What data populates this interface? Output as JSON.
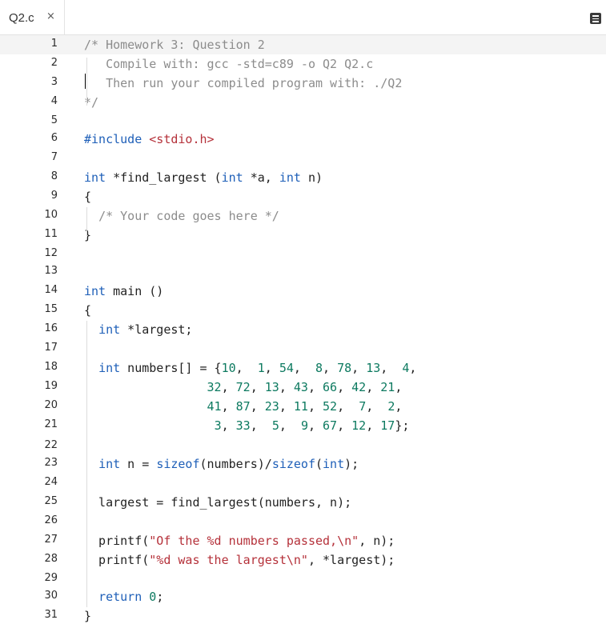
{
  "tab": {
    "title": "Q2.c",
    "close_icon": "×"
  },
  "menu": {
    "icon": "hamburger-menu-icon"
  },
  "colors": {
    "keyword": "#1e5fb8",
    "number": "#0d7a60",
    "string": "#b5313a",
    "comment": "#8c8c8c",
    "text": "#222222"
  },
  "lines": [
    [
      [
        "cm",
        "/* Homework 3: Question 2"
      ]
    ],
    [
      [
        "cm",
        "   Compile with: gcc -std=c89 -o Q2 Q2.c"
      ]
    ],
    [
      [
        "cm",
        "   Then run your compiled program with: ./Q2"
      ]
    ],
    [
      [
        "cm",
        "*/"
      ]
    ],
    [],
    [
      [
        "kw",
        "#include"
      ],
      [
        "t",
        " "
      ],
      [
        "str",
        "<stdio.h>"
      ]
    ],
    [],
    [
      [
        "kw",
        "int"
      ],
      [
        "t",
        " *find_largest ("
      ],
      [
        "kw",
        "int"
      ],
      [
        "t",
        " *a, "
      ],
      [
        "kw",
        "int"
      ],
      [
        "t",
        " n)"
      ]
    ],
    [
      [
        "t",
        "{"
      ]
    ],
    [
      [
        "t",
        "  "
      ],
      [
        "cm",
        "/* Your code goes here */"
      ]
    ],
    [
      [
        "t",
        "}"
      ]
    ],
    [],
    [],
    [
      [
        "kw",
        "int"
      ],
      [
        "t",
        " main ()"
      ]
    ],
    [
      [
        "t",
        "{"
      ]
    ],
    [
      [
        "t",
        "  "
      ],
      [
        "kw",
        "int"
      ],
      [
        "t",
        " *largest;"
      ]
    ],
    [],
    [
      [
        "t",
        "  "
      ],
      [
        "kw",
        "int"
      ],
      [
        "t",
        " numbers[] = {"
      ],
      [
        "num",
        "10"
      ],
      [
        "t",
        ",  "
      ],
      [
        "num",
        "1"
      ],
      [
        "t",
        ", "
      ],
      [
        "num",
        "54"
      ],
      [
        "t",
        ",  "
      ],
      [
        "num",
        "8"
      ],
      [
        "t",
        ", "
      ],
      [
        "num",
        "78"
      ],
      [
        "t",
        ", "
      ],
      [
        "num",
        "13"
      ],
      [
        "t",
        ",  "
      ],
      [
        "num",
        "4"
      ],
      [
        "t",
        ","
      ]
    ],
    [
      [
        "t",
        "                 "
      ],
      [
        "num",
        "32"
      ],
      [
        "t",
        ", "
      ],
      [
        "num",
        "72"
      ],
      [
        "t",
        ", "
      ],
      [
        "num",
        "13"
      ],
      [
        "t",
        ", "
      ],
      [
        "num",
        "43"
      ],
      [
        "t",
        ", "
      ],
      [
        "num",
        "66"
      ],
      [
        "t",
        ", "
      ],
      [
        "num",
        "42"
      ],
      [
        "t",
        ", "
      ],
      [
        "num",
        "21"
      ],
      [
        "t",
        ","
      ]
    ],
    [
      [
        "t",
        "                 "
      ],
      [
        "num",
        "41"
      ],
      [
        "t",
        ", "
      ],
      [
        "num",
        "87"
      ],
      [
        "t",
        ", "
      ],
      [
        "num",
        "23"
      ],
      [
        "t",
        ", "
      ],
      [
        "num",
        "11"
      ],
      [
        "t",
        ", "
      ],
      [
        "num",
        "52"
      ],
      [
        "t",
        ",  "
      ],
      [
        "num",
        "7"
      ],
      [
        "t",
        ",  "
      ],
      [
        "num",
        "2"
      ],
      [
        "t",
        ","
      ]
    ],
    [
      [
        "t",
        "                  "
      ],
      [
        "num",
        "3"
      ],
      [
        "t",
        ", "
      ],
      [
        "num",
        "33"
      ],
      [
        "t",
        ",  "
      ],
      [
        "num",
        "5"
      ],
      [
        "t",
        ",  "
      ],
      [
        "num",
        "9"
      ],
      [
        "t",
        ", "
      ],
      [
        "num",
        "67"
      ],
      [
        "t",
        ", "
      ],
      [
        "num",
        "12"
      ],
      [
        "t",
        ", "
      ],
      [
        "num",
        "17"
      ],
      [
        "t",
        "};"
      ]
    ],
    [],
    [
      [
        "t",
        "  "
      ],
      [
        "kw",
        "int"
      ],
      [
        "t",
        " n = "
      ],
      [
        "kw",
        "sizeof"
      ],
      [
        "t",
        "(numbers)/"
      ],
      [
        "kw",
        "sizeof"
      ],
      [
        "t",
        "("
      ],
      [
        "kw",
        "int"
      ],
      [
        "t",
        ");"
      ]
    ],
    [],
    [
      [
        "t",
        "  largest = find_largest(numbers, n);"
      ]
    ],
    [],
    [
      [
        "t",
        "  printf("
      ],
      [
        "str",
        "\"Of the %d numbers passed,\\n\""
      ],
      [
        "t",
        ", n);"
      ]
    ],
    [
      [
        "t",
        "  printf("
      ],
      [
        "str",
        "\"%d was the largest\\n\""
      ],
      [
        "t",
        ", *largest);"
      ]
    ],
    [],
    [
      [
        "t",
        "  "
      ],
      [
        "kw",
        "return"
      ],
      [
        "t",
        " "
      ],
      [
        "num",
        "0"
      ],
      [
        "t",
        ";"
      ]
    ],
    [
      [
        "t",
        "}"
      ]
    ]
  ]
}
